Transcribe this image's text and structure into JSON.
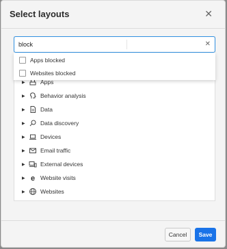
{
  "dialog": {
    "title": "Select layouts",
    "close_icon": "close-icon"
  },
  "search": {
    "value": "block",
    "clear_icon": "clear-icon"
  },
  "results": [
    {
      "label": "Apps blocked",
      "checked": false
    },
    {
      "label": "Websites blocked",
      "checked": false
    }
  ],
  "tree": [
    {
      "label": "Apps",
      "icon": "apps-icon"
    },
    {
      "label": "Behavior analysis",
      "icon": "behavior-analysis-icon"
    },
    {
      "label": "Data",
      "icon": "data-icon"
    },
    {
      "label": "Data discovery",
      "icon": "search-icon"
    },
    {
      "label": "Devices",
      "icon": "laptop-icon"
    },
    {
      "label": "Email traffic",
      "icon": "email-icon"
    },
    {
      "label": "External devices",
      "icon": "external-devices-icon"
    },
    {
      "label": "Website visits",
      "icon": "browser-icon"
    },
    {
      "label": "Websites",
      "icon": "globe-icon"
    }
  ],
  "footer": {
    "cancel_label": "Cancel",
    "save_label": "Save"
  },
  "colors": {
    "accent": "#1a73e8",
    "focus_border": "#2f8fe0"
  }
}
